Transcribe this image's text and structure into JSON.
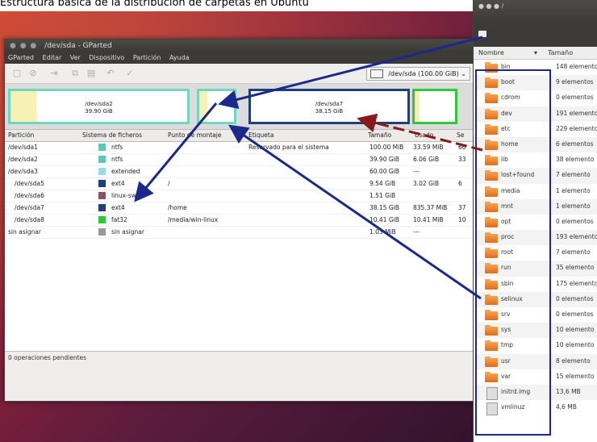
{
  "caption": "Estructura básica de la distribución de carpetas en Ubuntu",
  "gparted": {
    "title": "/dev/sda - GParted",
    "menu": [
      "GParted",
      "Editar",
      "Ver",
      "Dispositivo",
      "Partición",
      "Ayuda"
    ],
    "device": "/dev/sda (100.00 GiB)",
    "map": [
      {
        "name": "/dev/sda2",
        "size": "39.90 GiB"
      },
      {
        "name": "/dev/sda7",
        "size": "38.15 GiB"
      }
    ],
    "columns": [
      "Partición",
      "Sistema de ficheros",
      "Punto de montaje",
      "Etiqueta",
      "Tamaño",
      "Usado",
      "Se"
    ],
    "rows": [
      {
        "part": "/dev/sda1",
        "fs": "ntfs",
        "color": "#5ec8b4",
        "mount": "",
        "label": "Reservado para el sistema",
        "size": "100.00 MiB",
        "used": "33.59 MiB",
        "free": "66"
      },
      {
        "part": "/dev/sda2",
        "fs": "ntfs",
        "color": "#5ec8b4",
        "mount": "",
        "label": "",
        "size": "39.90 GiB",
        "used": "6.06 GiB",
        "free": "33"
      },
      {
        "part": "/dev/sda3",
        "fs": "extended",
        "color": "#9fd8e8",
        "mount": "",
        "label": "",
        "size": "60.00 GiB",
        "used": "---",
        "free": ""
      },
      {
        "part": "/dev/sda5",
        "fs": "ext4",
        "color": "#1f3f7a",
        "mount": "/",
        "label": "",
        "size": "9.54 GiB",
        "used": "3.02 GiB",
        "free": "6"
      },
      {
        "part": "/dev/sda6",
        "fs": "linux-swap",
        "color": "#8a5560",
        "mount": "",
        "label": "",
        "size": "1.51 GiB",
        "used": "",
        "free": ""
      },
      {
        "part": "/dev/sda7",
        "fs": "ext4",
        "color": "#1f3f7a",
        "mount": "/home",
        "label": "",
        "size": "38.15 GiB",
        "used": "835.37 MiB",
        "free": "37"
      },
      {
        "part": "/dev/sda8",
        "fs": "fat32",
        "color": "#2ec83b",
        "mount": "/media/win-linux",
        "label": "",
        "size": "10.41 GiB",
        "used": "10.41 MiB",
        "free": "10"
      },
      {
        "part": "sin asignar",
        "fs": "sin asignar",
        "color": "#9a9a9a",
        "mount": "",
        "label": "",
        "size": "1.03 MiB",
        "used": "---",
        "free": ""
      }
    ],
    "status": "0 operaciones pendientes"
  },
  "nautilus": {
    "title": "/",
    "col_name": "Nombre",
    "col_size": "Tamaño",
    "items": [
      {
        "name": "bin",
        "size": "148 elemento",
        "kind": "folder"
      },
      {
        "name": "boot",
        "size": "9 elementos",
        "kind": "folder"
      },
      {
        "name": "cdrom",
        "size": "0 elementos",
        "kind": "folder"
      },
      {
        "name": "dev",
        "size": "191 elemento",
        "kind": "folder"
      },
      {
        "name": "etc",
        "size": "229 elemento",
        "kind": "folder"
      },
      {
        "name": "home",
        "size": "6 elementos",
        "kind": "folder"
      },
      {
        "name": "lib",
        "size": "38 elemento",
        "kind": "folder"
      },
      {
        "name": "lost+found",
        "size": "7 elemento",
        "kind": "folder"
      },
      {
        "name": "media",
        "size": "1 elemento",
        "kind": "folder"
      },
      {
        "name": "mnt",
        "size": "1 elemento",
        "kind": "folder"
      },
      {
        "name": "opt",
        "size": "0 elementos",
        "kind": "folder"
      },
      {
        "name": "proc",
        "size": "193 elemento",
        "kind": "folder"
      },
      {
        "name": "root",
        "size": "7 elemento",
        "kind": "folder"
      },
      {
        "name": "run",
        "size": "35 elemento",
        "kind": "folder"
      },
      {
        "name": "sbin",
        "size": "175 elemento",
        "kind": "folder"
      },
      {
        "name": "selinux",
        "size": "0 elementos",
        "kind": "folder"
      },
      {
        "name": "srv",
        "size": "0 elementos",
        "kind": "folder"
      },
      {
        "name": "sys",
        "size": "10 elemento",
        "kind": "folder"
      },
      {
        "name": "tmp",
        "size": "10 elemento",
        "kind": "folder"
      },
      {
        "name": "usr",
        "size": "8 elemento",
        "kind": "folder"
      },
      {
        "name": "var",
        "size": "15 elemento",
        "kind": "folder"
      },
      {
        "name": "initrd.img",
        "size": "13,6 MB",
        "kind": "file"
      },
      {
        "name": "vmlinuz",
        "size": "4,6 MB",
        "kind": "file"
      }
    ]
  }
}
